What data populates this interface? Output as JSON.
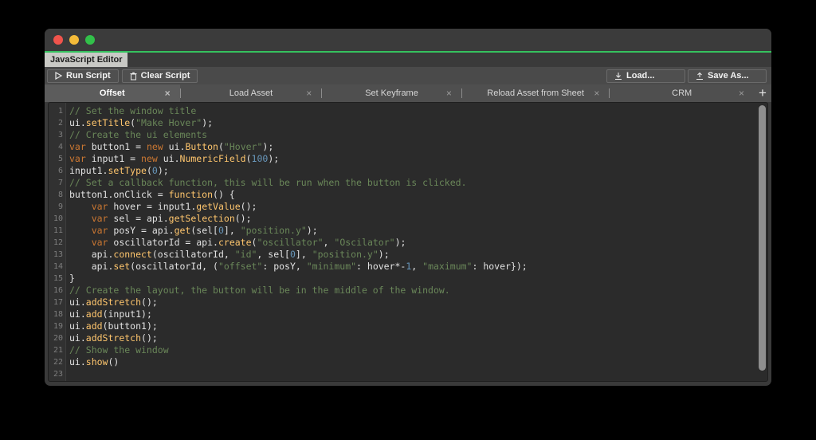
{
  "window": {
    "traffic_lights": [
      "close",
      "minimize",
      "zoom"
    ],
    "accent_color": "#35c15e"
  },
  "editor_tab": {
    "label": "JavaScript Editor"
  },
  "toolbar": {
    "run_label": "Run Script",
    "clear_label": "Clear Script",
    "load_label": "Load...",
    "save_label": "Save As..."
  },
  "script_tabs": {
    "close_glyph": "×",
    "add_glyph": "+",
    "items": [
      {
        "label": "Offset",
        "active": true
      },
      {
        "label": "Load Asset",
        "active": false
      },
      {
        "label": "Set Keyframe",
        "active": false
      },
      {
        "label": "Reload Asset from Sheet",
        "active": false
      },
      {
        "label": "CRM",
        "active": false
      }
    ]
  },
  "code": {
    "line_numbers": [
      "1",
      "2",
      "3",
      "4",
      "5",
      "6",
      "7",
      "8",
      "9",
      "10",
      "11",
      "12",
      "13",
      "14",
      "15",
      "16",
      "17",
      "18",
      "19",
      "20",
      "21",
      "22",
      "23"
    ],
    "lines": [
      "// Set the window title",
      "ui.setTitle(\"Make Hover\");",
      "// Create the ui elements",
      "var button1 = new ui.Button(\"Hover\");",
      "var input1 = new ui.NumericField(100);",
      "input1.setType(0);",
      "// Set a callback function, this will be run when the button is clicked.",
      "button1.onClick = function () {",
      "    var hover = input1.getValue();",
      "    var sel = api.getSelection();",
      "    var posY = api.get(sel[0], \"position.y\");",
      "    var oscillatorId = api.create(\"oscillator\", \"Oscilator\");",
      "    api.connect(oscillatorId, \"id\", sel[0], \"position.y\");",
      "    api.set(oscillatorId, (\"offset\": posY, \"minimum\": hover*-1, \"maximum\": hover});",
      "}",
      "// Create the layout, the button will be in the middle of the window.",
      "ui.addStretch();",
      "ui.add(input1);",
      "ui.add(button1);",
      "ui.addStretch();",
      "// Show the window",
      "ui.show()",
      ""
    ]
  }
}
